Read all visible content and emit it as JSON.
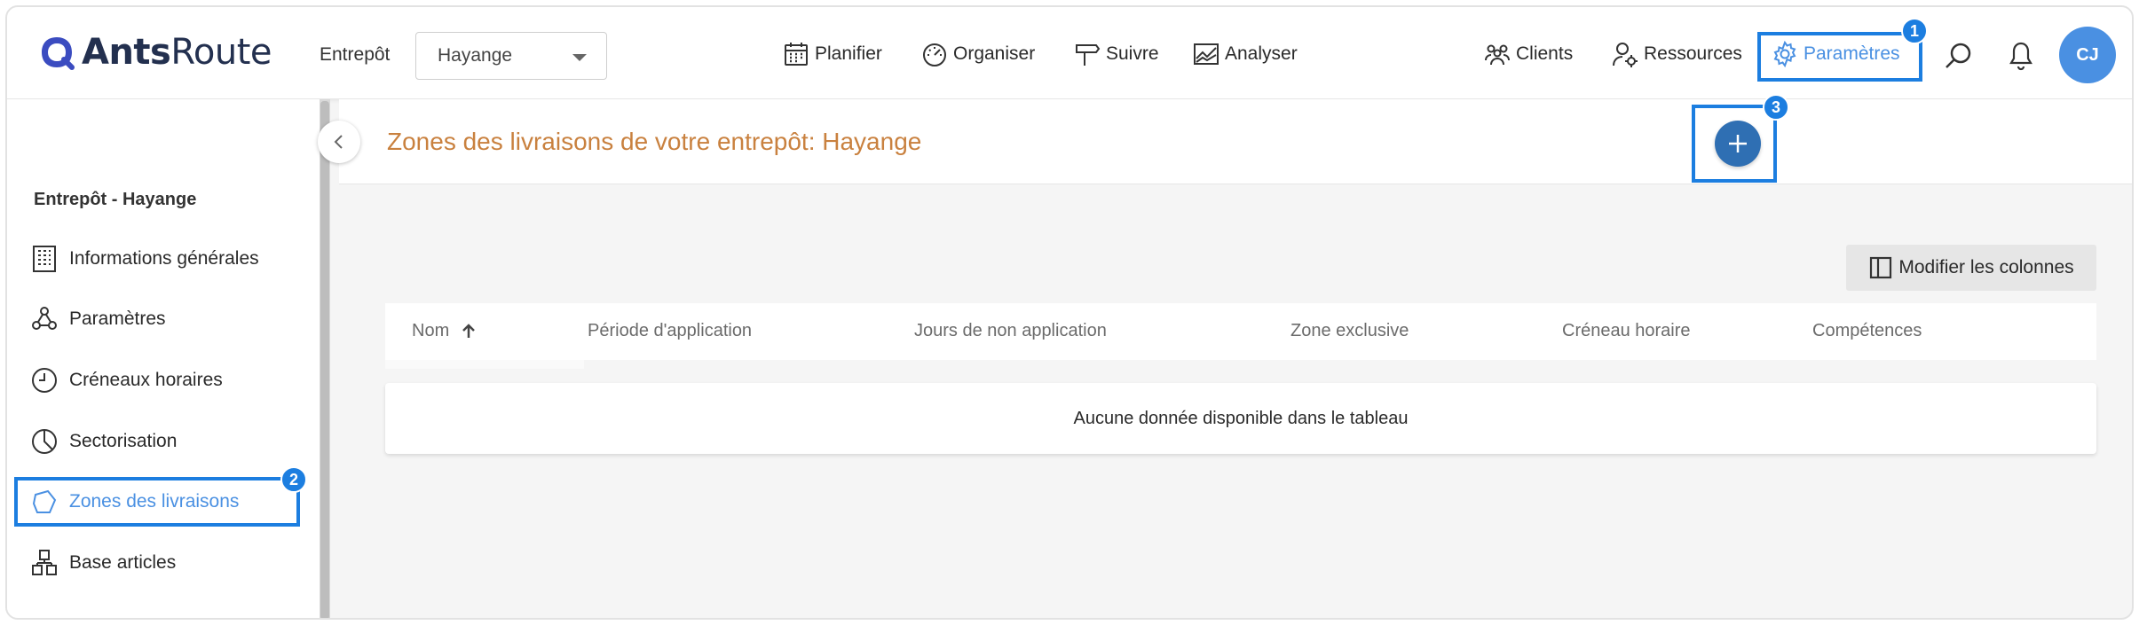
{
  "app": {
    "logo_bold": "Ants",
    "logo_regular": "Route"
  },
  "header": {
    "warehouse_label": "Entrepôt",
    "warehouse_value": "Hayange",
    "nav": [
      "Planifier",
      "Organiser",
      "Suivre",
      "Analyser"
    ],
    "right_nav": {
      "clients": "Clients",
      "resources": "Ressources",
      "settings": "Paramètres"
    },
    "avatar_initials": "CJ"
  },
  "badges": {
    "b1": "1",
    "b2": "2",
    "b3": "3"
  },
  "sidebar": {
    "title": "Entrepôt - Hayange",
    "items": [
      {
        "label": "Informations générales",
        "icon": "building-icon"
      },
      {
        "label": "Paramètres",
        "icon": "nodes-icon"
      },
      {
        "label": "Créneaux horaires",
        "icon": "clock-icon"
      },
      {
        "label": "Sectorisation",
        "icon": "pie-icon"
      },
      {
        "label": "Zones des livraisons",
        "icon": "polygon-icon",
        "active": true
      },
      {
        "label": "Base articles",
        "icon": "boxes-icon"
      }
    ]
  },
  "main": {
    "title": "Zones des livraisons de votre entrepôt: Hayange",
    "modify_columns": "Modifier les colonnes",
    "columns": [
      "Nom",
      "Période d'application",
      "Jours de non application",
      "Zone exclusive",
      "Créneau horaire",
      "Compétences"
    ],
    "empty_message": "Aucune donnée disponible dans le tableau"
  },
  "colors": {
    "accent": "#1c7ee0",
    "title": "#c9813f",
    "active": "#4a90e2",
    "add_button": "#2f6fb3"
  }
}
